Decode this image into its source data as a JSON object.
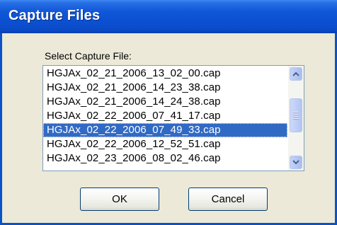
{
  "window": {
    "title": "Capture Files"
  },
  "dialog": {
    "label": "Select Capture File:"
  },
  "list": {
    "items": [
      "HGJAx_02_21_2006_13_02_00.cap",
      "HGJAx_02_21_2006_14_23_38.cap",
      "HGJAx_02_21_2006_14_24_38.cap",
      "HGJAx_02_22_2006_07_41_17.cap",
      "HGJAx_02_22_2006_07_49_33.cap",
      "HGJAx_02_22_2006_12_52_51.cap",
      "HGJAx_02_23_2006_08_02_46.cap"
    ],
    "selected_item": "HGJAx_02_22_2006_07_49_33.cap"
  },
  "buttons": {
    "ok": "OK",
    "cancel": "Cancel"
  },
  "colors": {
    "selection": "#316ac5",
    "titlebar": "#0b4fd0",
    "dialog_bg": "#ece9d8"
  },
  "icons": {
    "scroll_up": "chevron-up-icon",
    "scroll_down": "chevron-down-icon"
  }
}
